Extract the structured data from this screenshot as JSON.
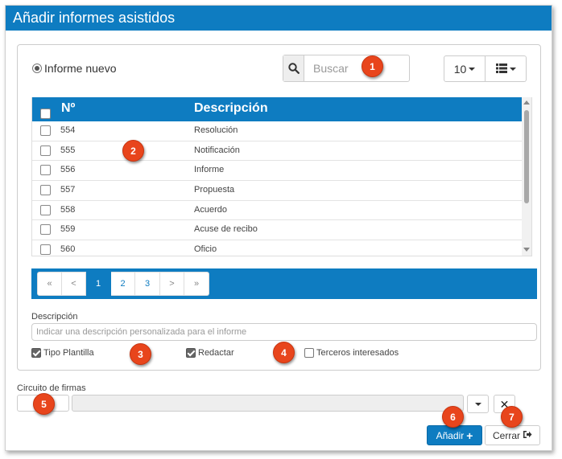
{
  "dialog": {
    "title": "Añadir informes asistidos"
  },
  "options": {
    "new_report_label": "Informe nuevo"
  },
  "search": {
    "placeholder": "Buscar"
  },
  "page_size": {
    "value": "10"
  },
  "table": {
    "headers": [
      "Nº",
      "Descripción"
    ],
    "rows": [
      {
        "num": "554",
        "desc": "Resolución"
      },
      {
        "num": "555",
        "desc": "Notificación"
      },
      {
        "num": "556",
        "desc": "Informe"
      },
      {
        "num": "557",
        "desc": "Propuesta"
      },
      {
        "num": "558",
        "desc": "Acuerdo"
      },
      {
        "num": "559",
        "desc": "Acuse de recibo"
      },
      {
        "num": "560",
        "desc": "Oficio"
      }
    ]
  },
  "pagination": {
    "first": "«",
    "prev": "<",
    "pages": [
      "1",
      "2",
      "3"
    ],
    "next": ">",
    "last": "»",
    "active_page": "1"
  },
  "description": {
    "label": "Descripción",
    "placeholder": "Indicar una descripción personalizada para el informe"
  },
  "checkboxes": {
    "tipo_plantilla": {
      "label": "Tipo Plantilla",
      "checked": true
    },
    "redactar": {
      "label": "Redactar",
      "checked": true
    },
    "terceros": {
      "label": "Terceros interesados",
      "checked": false
    }
  },
  "signature_circuit": {
    "label": "Circuito de firmas"
  },
  "buttons": {
    "add": "Añadir",
    "close": "Cerrar"
  },
  "badges": [
    "1",
    "2",
    "3",
    "4",
    "5",
    "6",
    "7"
  ],
  "colors": {
    "primary": "#0e7cc1",
    "badge": "#e8451c"
  },
  "icons": [
    "search-icon",
    "list-icon",
    "plus-icon",
    "exit-icon",
    "close-icon",
    "chevron-down-icon"
  ]
}
